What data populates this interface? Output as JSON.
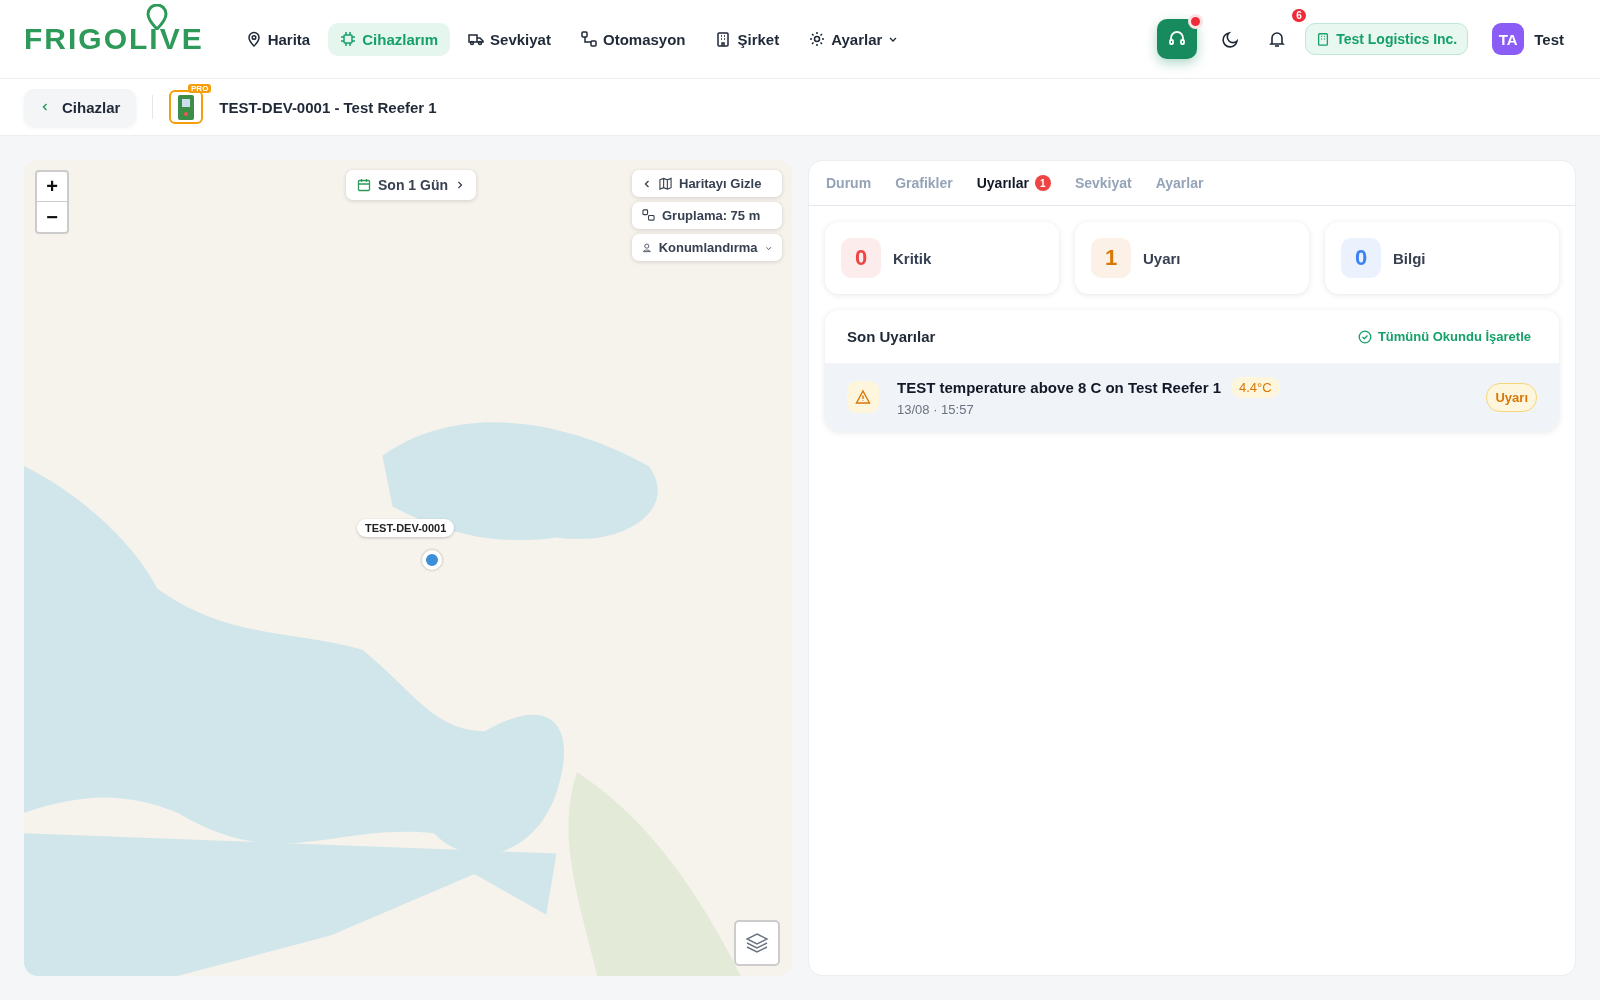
{
  "header": {
    "logo": "FRIGOLIVE",
    "nav": [
      {
        "label": "Harita",
        "kind": "map",
        "selected": false
      },
      {
        "label": "Cihazlarım",
        "kind": "devices",
        "selected": true
      },
      {
        "label": "Sevkiyat",
        "kind": "shipments",
        "selected": false
      },
      {
        "label": "Otomasyon",
        "kind": "automation",
        "selected": false
      },
      {
        "label": "Şirket",
        "kind": "company",
        "selected": false
      },
      {
        "label": "Ayarlar",
        "kind": "settings",
        "selected": false
      }
    ],
    "support_unread": true,
    "notification_count": "6",
    "company": "Test Logistics Inc.",
    "avatar_initials": "TA",
    "user_name": "Test"
  },
  "breadcrumb": {
    "back_label": "Cihazlar",
    "device_badge": "PRO",
    "device_title": "TEST-DEV-0001 - Test Reefer 1"
  },
  "map": {
    "range_label": "Son 1 Gün",
    "controls": [
      {
        "label": "Haritayı Gizle",
        "kind": "hide"
      },
      {
        "label": "Gruplama: 75 m",
        "kind": "group"
      },
      {
        "label": "Konumlandırma",
        "kind": "locate"
      }
    ],
    "zoom_in": "+",
    "zoom_out": "−",
    "marker_label": "TEST-DEV-0001"
  },
  "tabs": [
    {
      "label": "Durum",
      "selected": false
    },
    {
      "label": "Grafikler",
      "selected": false
    },
    {
      "label": "Uyarılar",
      "selected": true,
      "badge": "1"
    },
    {
      "label": "Sevkiyat",
      "selected": false
    },
    {
      "label": "Ayarlar",
      "selected": false
    }
  ],
  "summary": [
    {
      "count": "0",
      "label": "Kritik",
      "color": "#ef4444"
    },
    {
      "count": "1",
      "label": "Uyarı",
      "color": "#d97706"
    },
    {
      "count": "0",
      "label": "Bilgi",
      "color": "#3b82f6"
    }
  ],
  "alerts": {
    "title": "Son Uyarılar",
    "mark_all": "Tümünü Okundu İşaretle",
    "items": [
      {
        "message": "TEST temperature above 8 C on Test Reefer 1",
        "value": "4.4°C",
        "time": "13/08 · 15:57",
        "level": "Uyarı",
        "unread": true
      }
    ]
  }
}
